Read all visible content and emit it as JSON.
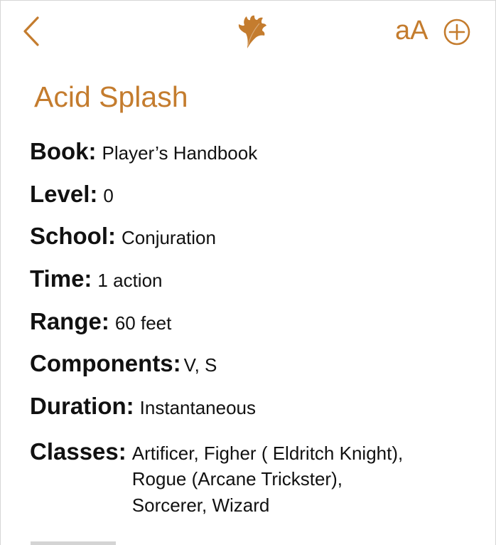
{
  "theme": {
    "accent": "#c47c2e",
    "text": "#111111",
    "border": "#d6d6d6"
  },
  "nav": {
    "back_icon": "chevron-left-icon",
    "logo_icon": "leaf-icon",
    "text_size_label": "aA",
    "add_icon": "plus-circle-icon"
  },
  "spell": {
    "title": "Acid Splash",
    "fields": {
      "book": {
        "label": "Book:",
        "value": "Player’s Handbook"
      },
      "level": {
        "label": "Level:",
        "value": "0"
      },
      "school": {
        "label": "School:",
        "value": "Conjuration"
      },
      "time": {
        "label": "Time:",
        "value": "1 action"
      },
      "range": {
        "label": "Range:",
        "value": "60 feet"
      },
      "components": {
        "label": "Components:",
        "value": "V, S"
      },
      "duration": {
        "label": "Duration:",
        "value": "Instantaneous"
      },
      "classes": {
        "label": "Classes:",
        "lines": [
          "Artificer, Figher ( Eldritch Knight),",
          "Rogue (Arcane Trickster),",
          "Sorcerer, Wizard"
        ]
      }
    }
  }
}
